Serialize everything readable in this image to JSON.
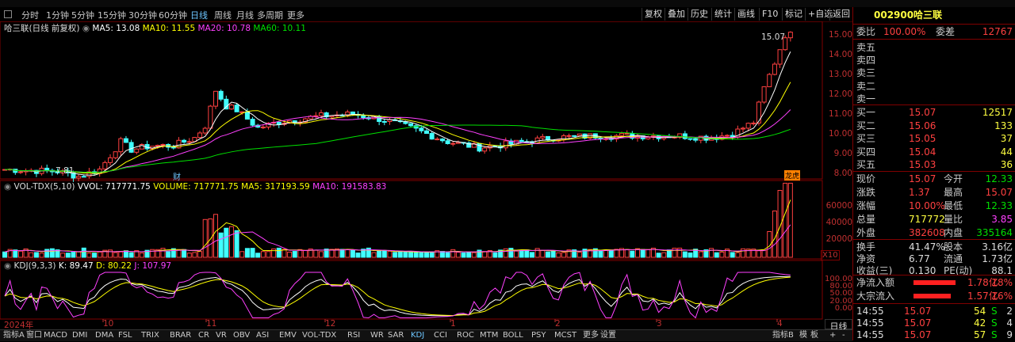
{
  "periods": [
    "分时",
    "1分钟",
    "5分钟",
    "15分钟",
    "30分钟",
    "60分钟",
    "日线",
    "周线",
    "月线",
    "多周期",
    "更多"
  ],
  "active_period": "日线",
  "toolbar": [
    "复权",
    "叠加",
    "历史",
    "统计",
    "画线",
    "F10",
    "标记",
    "+自选",
    "返回"
  ],
  "chart_header": {
    "name": "哈三联(日线 前复权)",
    "ma5": "MA5: 13.08",
    "ma10": "MA10: 11.55",
    "ma20": "MA20: 10.78",
    "ma60": "MA60: 10.11"
  },
  "price_axis": [
    "15.00",
    "14.00",
    "13.00",
    "12.00",
    "11.00",
    "10.00",
    "9.00",
    "8.00"
  ],
  "high_label": "15.07",
  "low_label": "7.81",
  "marker_cai": "财",
  "marker_ls": "龙虎",
  "vol_header": {
    "name": "VOL-TDX(5,10)",
    "vvol": "VVOL: 717771.75",
    "volume": "VOLUME: 717771.75",
    "ma5": "MA5: 317193.59",
    "ma10": "MA10: 191583.83"
  },
  "vol_axis": [
    "60000",
    "40000",
    "20000"
  ],
  "vol_unit": "X10",
  "kdj_header": {
    "name": "KDJ(9,3,3)",
    "k": "K: 89.47",
    "d": "D: 80.22",
    "j": "J: 107.97"
  },
  "kdj_axis": [
    "100.00",
    "80.00",
    "50.00",
    "20.00",
    "0.00"
  ],
  "dates": [
    "2024年",
    "10",
    "11",
    "12",
    "1",
    "2",
    "3",
    "4"
  ],
  "period_unit": "日线",
  "bottom_tabs": [
    "指标A",
    "窗口",
    "MACD",
    "DMI",
    "DMA",
    "FSL",
    "TRIX",
    "BRAR",
    "CR",
    "VR",
    "OBV",
    "ASI",
    "EMV",
    "VOL-TDX",
    "RSI",
    "WR",
    "SAR",
    "KDJ",
    "CCI",
    "ROC",
    "MTM",
    "BOLL",
    "PSY",
    "MCST",
    "更多",
    "设置"
  ],
  "active_bottom_tab": "KDJ",
  "bottom_right": [
    "指标B",
    "模",
    "板",
    "+",
    "-"
  ],
  "stock": {
    "code": "002900",
    "name": "哈三联"
  },
  "weibi": {
    "label1": "委比",
    "val1": "100.00%",
    "label2": "委差",
    "val2": "12767"
  },
  "sell": [
    {
      "label": "卖五"
    },
    {
      "label": "卖四"
    },
    {
      "label": "卖三"
    },
    {
      "label": "卖二"
    },
    {
      "label": "卖一"
    }
  ],
  "buy": [
    {
      "label": "买一",
      "price": "15.07",
      "vol": "12517"
    },
    {
      "label": "买二",
      "price": "15.06",
      "vol": "133"
    },
    {
      "label": "买三",
      "price": "15.05",
      "vol": "37"
    },
    {
      "label": "买四",
      "price": "15.04",
      "vol": "44"
    },
    {
      "label": "买五",
      "price": "15.03",
      "vol": "36"
    }
  ],
  "quote": [
    {
      "l1": "现价",
      "v1": "15.07",
      "l2": "今开",
      "v2": "12.33",
      "c1": "#ff4040",
      "c2": "#00e000"
    },
    {
      "l1": "涨跌",
      "v1": "1.37",
      "l2": "最高",
      "v2": "15.07",
      "c1": "#ff4040",
      "c2": "#ff4040"
    },
    {
      "l1": "涨幅",
      "v1": "10.00%",
      "l2": "最低",
      "v2": "12.33",
      "c1": "#ff4040",
      "c2": "#00e000"
    },
    {
      "l1": "总量",
      "v1": "717772",
      "l2": "量比",
      "v2": "3.85",
      "c1": "#ffff40",
      "c2": "#ff40ff"
    },
    {
      "l1": "外盘",
      "v1": "382608",
      "l2": "内盘",
      "v2": "335164",
      "c1": "#ff4040",
      "c2": "#00e000"
    }
  ],
  "quote2": [
    {
      "l1": "换手",
      "v1": "41.47%",
      "l2": "股本",
      "v2": "3.16亿"
    },
    {
      "l1": "净资",
      "v1": "6.77",
      "l2": "流通",
      "v2": "1.73亿"
    },
    {
      "l1": "收益(三)",
      "v1": "0.130",
      "l2": "PE(动)",
      "v2": "88.1"
    }
  ],
  "flow": [
    {
      "label": "净流入额",
      "val": "1.78亿",
      "pct": "18%",
      "bar": 0.85
    },
    {
      "label": "大宗流入",
      "val": "1.57亿",
      "pct": "16%",
      "bar": 0.75
    }
  ],
  "ticks": [
    {
      "time": "14:55",
      "price": "15.07",
      "vol": "54",
      "side": "S",
      "n": "2"
    },
    {
      "time": "14:55",
      "price": "15.07",
      "vol": "42",
      "side": "S",
      "n": "4"
    },
    {
      "time": "14:55",
      "price": "15.07",
      "vol": "57",
      "side": "S",
      "n": "9"
    }
  ],
  "colors": {
    "up": "#ff4040",
    "down": "#40ffff",
    "ma5": "#ffffff",
    "ma10": "#ffff00",
    "ma20": "#ff40ff",
    "ma60": "#00e000",
    "link": "#6ec6ff"
  }
}
